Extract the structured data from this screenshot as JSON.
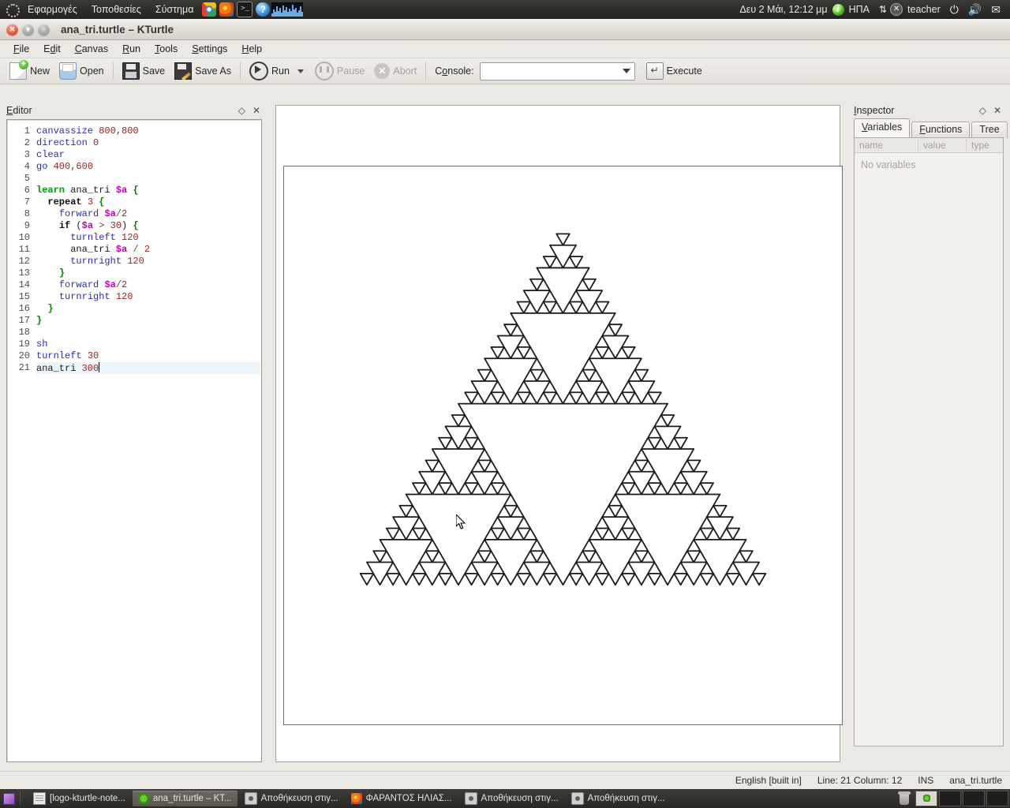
{
  "gnome_panel": {
    "menus": [
      "Εφαρμογές",
      "Τοποθεσίες",
      "Σύστημα"
    ],
    "launcher_icons": [
      "chrome-icon",
      "firefox-icon",
      "terminal-icon",
      "help-icon"
    ],
    "terminal_glyph": ">_",
    "help_glyph": "?",
    "clock": "Δευ  2 Μάι, 12:12 μμ",
    "keyboard_layout": "ΗΠΑ",
    "user": "teacher",
    "tray_icons": [
      "system-monitor-icon",
      "info-icon",
      "network-icon",
      "user-icon",
      "power-icon",
      "volume-icon",
      "mail-icon"
    ],
    "power_glyph": "⏻",
    "volume_glyph": "🔊",
    "mail_glyph": "✉",
    "net_glyph": "⇅",
    "user_glyph": "✕",
    "info_glyph": "i"
  },
  "window": {
    "title": "ana_tri.turtle – KTurtle",
    "buttons": {
      "close": "✕",
      "minimize": "▾",
      "maximize": "▫"
    }
  },
  "menubar": [
    {
      "label": "File",
      "accel": "F"
    },
    {
      "label": "Edit",
      "accel": "d"
    },
    {
      "label": "Canvas",
      "accel": "C"
    },
    {
      "label": "Run",
      "accel": "R"
    },
    {
      "label": "Tools",
      "accel": "T"
    },
    {
      "label": "Settings",
      "accel": "S"
    },
    {
      "label": "Help",
      "accel": "H"
    }
  ],
  "toolbar": {
    "new_label": "New",
    "open_label": "Open",
    "save_label": "Save",
    "save_as_label": "Save As",
    "run_label": "Run",
    "pause_label": "Pause",
    "abort_label": "Abort",
    "console_label": "Console:",
    "console_value": "",
    "console_placeholder": "",
    "execute_label": "Execute"
  },
  "editor": {
    "title": "Editor",
    "title_accel": "E",
    "float_glyph": "◇",
    "close_glyph": "✕",
    "cursor_line": 21,
    "lines": [
      {
        "n": 1,
        "tokens": [
          {
            "t": "canvassize",
            "c": "cmd"
          },
          {
            "t": " ",
            "c": "plain"
          },
          {
            "t": "800,800",
            "c": "num"
          }
        ]
      },
      {
        "n": 2,
        "tokens": [
          {
            "t": "direction",
            "c": "cmd"
          },
          {
            "t": " ",
            "c": "plain"
          },
          {
            "t": "0",
            "c": "num"
          }
        ]
      },
      {
        "n": 3,
        "tokens": [
          {
            "t": "clear",
            "c": "cmd"
          }
        ]
      },
      {
        "n": 4,
        "tokens": [
          {
            "t": "go",
            "c": "cmd"
          },
          {
            "t": " ",
            "c": "plain"
          },
          {
            "t": "400,600",
            "c": "num"
          }
        ]
      },
      {
        "n": 5,
        "tokens": []
      },
      {
        "n": 6,
        "tokens": [
          {
            "t": "learn",
            "c": "learn"
          },
          {
            "t": " ana_tri ",
            "c": "plain"
          },
          {
            "t": "$a",
            "c": "var"
          },
          {
            "t": " ",
            "c": "plain"
          },
          {
            "t": "{",
            "c": "brace"
          }
        ]
      },
      {
        "n": 7,
        "tokens": [
          {
            "t": "  ",
            "c": "plain"
          },
          {
            "t": "repeat",
            "c": "ctl"
          },
          {
            "t": " ",
            "c": "plain"
          },
          {
            "t": "3",
            "c": "num"
          },
          {
            "t": " ",
            "c": "plain"
          },
          {
            "t": "{",
            "c": "brace"
          }
        ]
      },
      {
        "n": 8,
        "tokens": [
          {
            "t": "    ",
            "c": "plain"
          },
          {
            "t": "forward",
            "c": "cmd"
          },
          {
            "t": " ",
            "c": "plain"
          },
          {
            "t": "$a",
            "c": "var"
          },
          {
            "t": "/",
            "c": "op"
          },
          {
            "t": "2",
            "c": "num"
          }
        ]
      },
      {
        "n": 9,
        "tokens": [
          {
            "t": "    ",
            "c": "plain"
          },
          {
            "t": "if",
            "c": "ctl"
          },
          {
            "t": " (",
            "c": "plain"
          },
          {
            "t": "$a",
            "c": "var"
          },
          {
            "t": " ",
            "c": "plain"
          },
          {
            "t": ">",
            "c": "op"
          },
          {
            "t": " ",
            "c": "plain"
          },
          {
            "t": "30",
            "c": "num"
          },
          {
            "t": ") ",
            "c": "plain"
          },
          {
            "t": "{",
            "c": "brace"
          }
        ]
      },
      {
        "n": 10,
        "tokens": [
          {
            "t": "      ",
            "c": "plain"
          },
          {
            "t": "turnleft",
            "c": "cmd"
          },
          {
            "t": " ",
            "c": "plain"
          },
          {
            "t": "120",
            "c": "num"
          }
        ]
      },
      {
        "n": 11,
        "tokens": [
          {
            "t": "      ana_tri ",
            "c": "plain"
          },
          {
            "t": "$a",
            "c": "var"
          },
          {
            "t": " ",
            "c": "plain"
          },
          {
            "t": "/",
            "c": "op"
          },
          {
            "t": " ",
            "c": "plain"
          },
          {
            "t": "2",
            "c": "num"
          }
        ]
      },
      {
        "n": 12,
        "tokens": [
          {
            "t": "      ",
            "c": "plain"
          },
          {
            "t": "turnright",
            "c": "cmd"
          },
          {
            "t": " ",
            "c": "plain"
          },
          {
            "t": "120",
            "c": "num"
          }
        ]
      },
      {
        "n": 13,
        "tokens": [
          {
            "t": "    ",
            "c": "plain"
          },
          {
            "t": "}",
            "c": "brace"
          }
        ]
      },
      {
        "n": 14,
        "tokens": [
          {
            "t": "    ",
            "c": "plain"
          },
          {
            "t": "forward",
            "c": "cmd"
          },
          {
            "t": " ",
            "c": "plain"
          },
          {
            "t": "$a",
            "c": "var"
          },
          {
            "t": "/",
            "c": "op"
          },
          {
            "t": "2",
            "c": "num"
          }
        ]
      },
      {
        "n": 15,
        "tokens": [
          {
            "t": "    ",
            "c": "plain"
          },
          {
            "t": "turnright",
            "c": "cmd"
          },
          {
            "t": " ",
            "c": "plain"
          },
          {
            "t": "120",
            "c": "num"
          }
        ]
      },
      {
        "n": 16,
        "tokens": [
          {
            "t": "  ",
            "c": "plain"
          },
          {
            "t": "}",
            "c": "brace"
          }
        ]
      },
      {
        "n": 17,
        "tokens": [
          {
            "t": "}",
            "c": "brace"
          }
        ]
      },
      {
        "n": 18,
        "tokens": []
      },
      {
        "n": 19,
        "tokens": [
          {
            "t": "sh",
            "c": "cmd"
          }
        ]
      },
      {
        "n": 20,
        "tokens": [
          {
            "t": "turnleft",
            "c": "cmd"
          },
          {
            "t": " ",
            "c": "plain"
          },
          {
            "t": "30",
            "c": "num"
          }
        ]
      },
      {
        "n": 21,
        "tokens": [
          {
            "t": "ana_tri ",
            "c": "plain"
          },
          {
            "t": "300",
            "c": "num"
          }
        ]
      }
    ]
  },
  "canvas": {
    "size": "800,800",
    "start": "400,600",
    "direction": 0,
    "initial_turnleft": 30,
    "call_size": 300,
    "min_size": 30,
    "stroke": "#1a1a1a"
  },
  "inspector": {
    "title": "Inspector",
    "title_accel": "I",
    "float_glyph": "◇",
    "close_glyph": "✕",
    "tabs": [
      {
        "label": "Variables",
        "accel": "V",
        "active": true
      },
      {
        "label": "Functions",
        "accel": "F",
        "active": false
      },
      {
        "label": "Tree",
        "accel": "",
        "active": false
      }
    ],
    "table_headers": [
      "name",
      "value",
      "type"
    ],
    "empty_text": "No variables"
  },
  "statusbar": {
    "language": "English [built in]",
    "position": "Line: 21 Column: 12",
    "insert_mode": "INS",
    "filename": "ana_tri.turtle"
  },
  "taskbar": {
    "show_desktop": "show-desktop-icon",
    "tasks": [
      {
        "label": "[logo-kturtle-note...",
        "icon": "document-icon",
        "active": false
      },
      {
        "label": "ana_tri.turtle – KT...",
        "icon": "kturtle-icon",
        "active": true
      },
      {
        "label": "Αποθήκευση στιγ...",
        "icon": "screenshot-icon",
        "active": false
      },
      {
        "label": "ΦΑΡΑΝΤΟΣ ΗΛΙΑΣ...",
        "icon": "firefox-icon",
        "active": false
      },
      {
        "label": "Αποθήκευση στιγ...",
        "icon": "screenshot-icon",
        "active": false
      },
      {
        "label": "Αποθήκευση στιγ...",
        "icon": "screenshot-icon",
        "active": false
      }
    ],
    "trash": "trash-icon",
    "workspaces": 4,
    "active_workspace": 1
  }
}
